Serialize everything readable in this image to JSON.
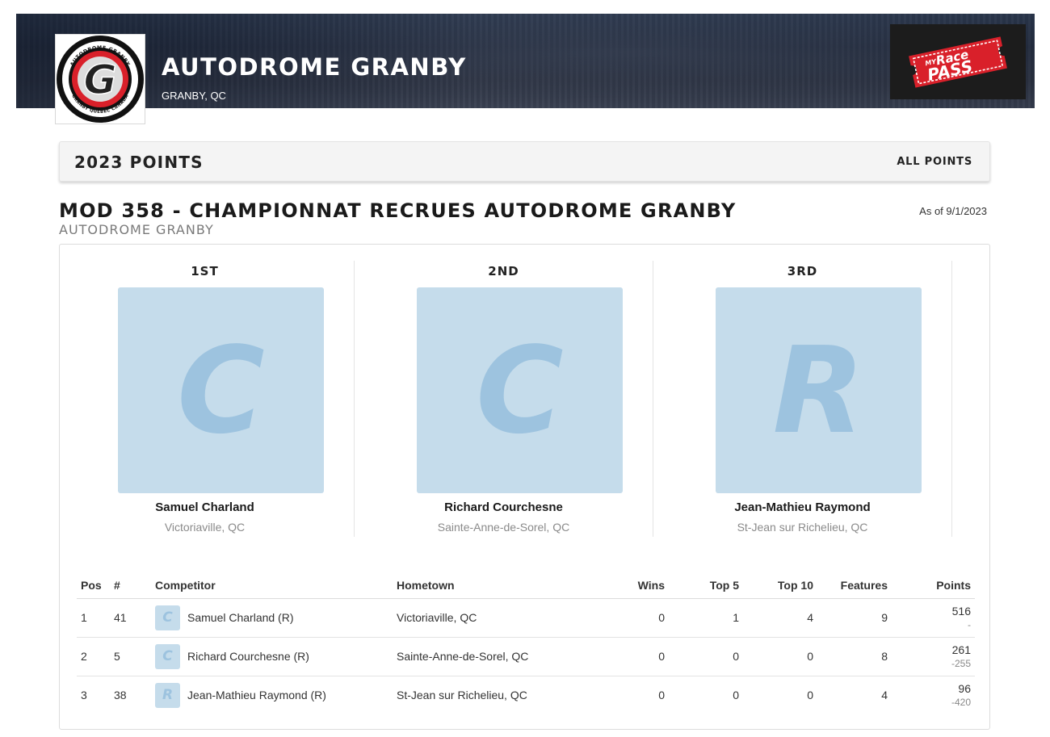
{
  "header": {
    "track_name": "AUTODROME GRANBY",
    "track_location": "GRANBY, QC",
    "logo_ring_top": "AUTODROME GRANBY",
    "logo_ring_bottom": "GRANBY QUEBEC CANADA",
    "logo_letter": "G",
    "brand_logo_small": "MY",
    "brand_logo_line1": "Race",
    "brand_logo_line2": "PASS"
  },
  "points_bar": {
    "title": "2023 POINTS",
    "all_points_label": "ALL POINTS"
  },
  "class": {
    "title": "MOD 358 - CHAMPIONNAT RECRUES AUTODROME GRANBY",
    "subtitle": "AUTODROME GRANBY",
    "as_of": "As of 9/1/2023"
  },
  "podium": [
    {
      "place": "1ST",
      "initial": "C",
      "name": "Samuel Charland",
      "hometown": "Victoriaville, QC"
    },
    {
      "place": "2ND",
      "initial": "C",
      "name": "Richard Courchesne",
      "hometown": "Sainte-Anne-de-Sorel, QC"
    },
    {
      "place": "3RD",
      "initial": "R",
      "name": "Jean-Mathieu Raymond",
      "hometown": "St-Jean sur Richelieu, QC"
    }
  ],
  "table": {
    "headers": {
      "pos": "Pos",
      "num": "#",
      "competitor": "Competitor",
      "hometown": "Hometown",
      "wins": "Wins",
      "top5": "Top 5",
      "top10": "Top 10",
      "features": "Features",
      "points": "Points"
    },
    "rows": [
      {
        "pos": "1",
        "num": "41",
        "initial": "C",
        "competitor": "Samuel Charland (R)",
        "hometown": "Victoriaville, QC",
        "wins": "0",
        "top5": "1",
        "top10": "4",
        "features": "9",
        "points": "516",
        "diff": "-"
      },
      {
        "pos": "2",
        "num": "5",
        "initial": "C",
        "competitor": "Richard Courchesne (R)",
        "hometown": "Sainte-Anne-de-Sorel, QC",
        "wins": "0",
        "top5": "0",
        "top10": "0",
        "features": "8",
        "points": "261",
        "diff": "-255"
      },
      {
        "pos": "3",
        "num": "38",
        "initial": "R",
        "competitor": "Jean-Mathieu Raymond (R)",
        "hometown": "St-Jean sur Richelieu, QC",
        "wins": "0",
        "top5": "0",
        "top10": "0",
        "features": "4",
        "points": "96",
        "diff": "-420"
      }
    ]
  },
  "colors": {
    "placeholder_bg": "#c5dceb",
    "placeholder_letter": "#9dc3df",
    "brand_red": "#d9202a"
  },
  "icons": [
    "autodrome-granby-logo-icon",
    "myracepass-logo-icon"
  ]
}
